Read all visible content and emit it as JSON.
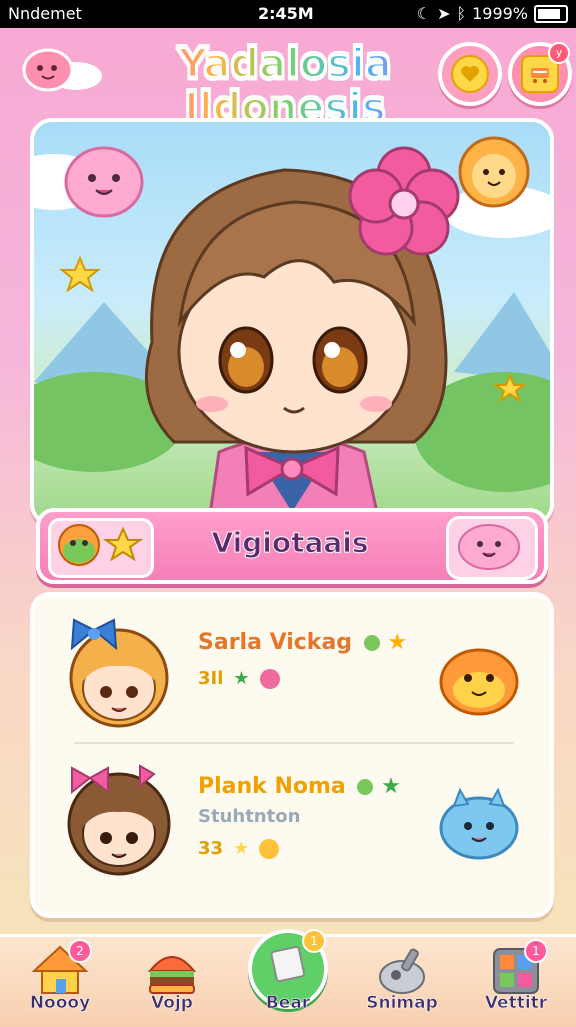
{
  "status_bar": {
    "carrier": "Nndemet",
    "time": "2:45M",
    "battery": "1999%"
  },
  "header": {
    "title_line1": "Yadalosia",
    "title_line2": "Ildonesis",
    "cart_badge": "y"
  },
  "hero": {
    "character_name": "Vigiotaais"
  },
  "friends": [
    {
      "name": "Sarla Vickag",
      "stats": [
        "3Il"
      ],
      "name_color": "#e8762a"
    },
    {
      "name": "Plank Noma",
      "subtitle": "Stuhtnton",
      "stats": [
        "33"
      ],
      "name_color": "#f0a000"
    }
  ],
  "nav": {
    "items": [
      {
        "label": "Noooy",
        "badge": "2",
        "icon": "home-icon"
      },
      {
        "label": "Vojp",
        "badge": "",
        "icon": "burger-icon"
      },
      {
        "label": "Bear",
        "badge": "1",
        "icon": "paper-icon",
        "active": true
      },
      {
        "label": "Snimap",
        "badge": "",
        "icon": "gadget-icon"
      },
      {
        "label": "Vettitr",
        "badge": "1",
        "icon": "grid-icon"
      }
    ]
  },
  "colors": {
    "accent_pink": "#f57fb8",
    "active_green": "#5fcf68",
    "gold": "#ffd84a"
  }
}
